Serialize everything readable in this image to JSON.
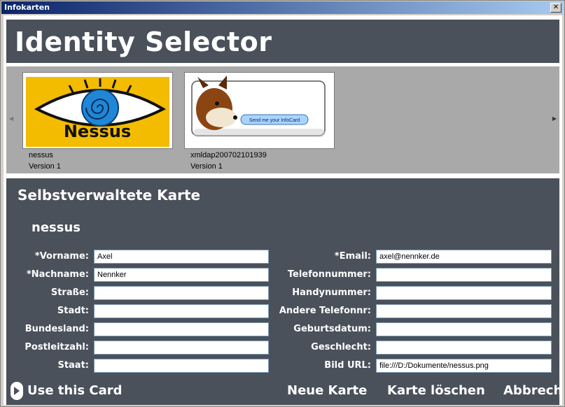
{
  "window": {
    "title": "Infokarten",
    "close_label": "✕"
  },
  "header": {
    "title": "Identity Selector"
  },
  "cards": [
    {
      "name": "nessus",
      "version": "Version 1",
      "image_alt": "Nessus eye logo"
    },
    {
      "name": "xmldap200702101939",
      "version": "Version 1",
      "button_text": "Send me your InfoCard"
    }
  ],
  "nessus_logo_text": "Nessus",
  "detail": {
    "section_title": "Selbstverwaltete Karte",
    "card_title": "nessus",
    "left_fields": [
      {
        "label": "*Vorname:",
        "value": "Axel"
      },
      {
        "label": "*Nachname:",
        "value": "Nennker"
      },
      {
        "label": "Straße:",
        "value": ""
      },
      {
        "label": "Stadt:",
        "value": ""
      },
      {
        "label": "Bundesland:",
        "value": ""
      },
      {
        "label": "Postleitzahl:",
        "value": ""
      },
      {
        "label": "Staat:",
        "value": ""
      }
    ],
    "right_fields": [
      {
        "label": "*Email:",
        "value": "axel@nennker.de"
      },
      {
        "label": "Telefonnummer:",
        "value": ""
      },
      {
        "label": "Handynummer:",
        "value": ""
      },
      {
        "label": "Andere Telefonnr:",
        "value": ""
      },
      {
        "label": "Geburtsdatum:",
        "value": ""
      },
      {
        "label": "Geschlecht:",
        "value": ""
      },
      {
        "label": "Bild URL:",
        "value": "file:///D:/Dokumente/nessus.png"
      }
    ]
  },
  "actions": {
    "use_card": "Use this Card",
    "new_card": "Neue Karte",
    "delete_card": "Karte löschen",
    "cancel": "Abbrech"
  },
  "colors": {
    "panel": "#4a515b",
    "strip": "#a9a9a9",
    "titlebar": "#0a246a"
  }
}
